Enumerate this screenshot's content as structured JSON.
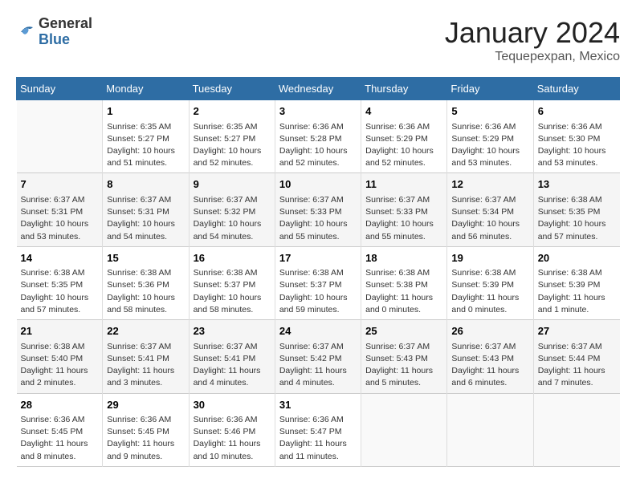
{
  "header": {
    "logo_general": "General",
    "logo_blue": "Blue",
    "month_title": "January 2024",
    "location": "Tequepexpan, Mexico"
  },
  "days_of_week": [
    "Sunday",
    "Monday",
    "Tuesday",
    "Wednesday",
    "Thursday",
    "Friday",
    "Saturday"
  ],
  "weeks": [
    [
      {
        "day": "",
        "empty": true
      },
      {
        "day": "1",
        "sunrise": "6:35 AM",
        "sunset": "5:27 PM",
        "daylight": "10 hours and 51 minutes."
      },
      {
        "day": "2",
        "sunrise": "6:35 AM",
        "sunset": "5:27 PM",
        "daylight": "10 hours and 52 minutes."
      },
      {
        "day": "3",
        "sunrise": "6:36 AM",
        "sunset": "5:28 PM",
        "daylight": "10 hours and 52 minutes."
      },
      {
        "day": "4",
        "sunrise": "6:36 AM",
        "sunset": "5:29 PM",
        "daylight": "10 hours and 52 minutes."
      },
      {
        "day": "5",
        "sunrise": "6:36 AM",
        "sunset": "5:29 PM",
        "daylight": "10 hours and 53 minutes."
      },
      {
        "day": "6",
        "sunrise": "6:36 AM",
        "sunset": "5:30 PM",
        "daylight": "10 hours and 53 minutes."
      }
    ],
    [
      {
        "day": "7",
        "sunrise": "6:37 AM",
        "sunset": "5:31 PM",
        "daylight": "10 hours and 53 minutes."
      },
      {
        "day": "8",
        "sunrise": "6:37 AM",
        "sunset": "5:31 PM",
        "daylight": "10 hours and 54 minutes."
      },
      {
        "day": "9",
        "sunrise": "6:37 AM",
        "sunset": "5:32 PM",
        "daylight": "10 hours and 54 minutes."
      },
      {
        "day": "10",
        "sunrise": "6:37 AM",
        "sunset": "5:33 PM",
        "daylight": "10 hours and 55 minutes."
      },
      {
        "day": "11",
        "sunrise": "6:37 AM",
        "sunset": "5:33 PM",
        "daylight": "10 hours and 55 minutes."
      },
      {
        "day": "12",
        "sunrise": "6:37 AM",
        "sunset": "5:34 PM",
        "daylight": "10 hours and 56 minutes."
      },
      {
        "day": "13",
        "sunrise": "6:38 AM",
        "sunset": "5:35 PM",
        "daylight": "10 hours and 57 minutes."
      }
    ],
    [
      {
        "day": "14",
        "sunrise": "6:38 AM",
        "sunset": "5:35 PM",
        "daylight": "10 hours and 57 minutes."
      },
      {
        "day": "15",
        "sunrise": "6:38 AM",
        "sunset": "5:36 PM",
        "daylight": "10 hours and 58 minutes."
      },
      {
        "day": "16",
        "sunrise": "6:38 AM",
        "sunset": "5:37 PM",
        "daylight": "10 hours and 58 minutes."
      },
      {
        "day": "17",
        "sunrise": "6:38 AM",
        "sunset": "5:37 PM",
        "daylight": "10 hours and 59 minutes."
      },
      {
        "day": "18",
        "sunrise": "6:38 AM",
        "sunset": "5:38 PM",
        "daylight": "11 hours and 0 minutes."
      },
      {
        "day": "19",
        "sunrise": "6:38 AM",
        "sunset": "5:39 PM",
        "daylight": "11 hours and 0 minutes."
      },
      {
        "day": "20",
        "sunrise": "6:38 AM",
        "sunset": "5:39 PM",
        "daylight": "11 hours and 1 minute."
      }
    ],
    [
      {
        "day": "21",
        "sunrise": "6:38 AM",
        "sunset": "5:40 PM",
        "daylight": "11 hours and 2 minutes."
      },
      {
        "day": "22",
        "sunrise": "6:37 AM",
        "sunset": "5:41 PM",
        "daylight": "11 hours and 3 minutes."
      },
      {
        "day": "23",
        "sunrise": "6:37 AM",
        "sunset": "5:41 PM",
        "daylight": "11 hours and 4 minutes."
      },
      {
        "day": "24",
        "sunrise": "6:37 AM",
        "sunset": "5:42 PM",
        "daylight": "11 hours and 4 minutes."
      },
      {
        "day": "25",
        "sunrise": "6:37 AM",
        "sunset": "5:43 PM",
        "daylight": "11 hours and 5 minutes."
      },
      {
        "day": "26",
        "sunrise": "6:37 AM",
        "sunset": "5:43 PM",
        "daylight": "11 hours and 6 minutes."
      },
      {
        "day": "27",
        "sunrise": "6:37 AM",
        "sunset": "5:44 PM",
        "daylight": "11 hours and 7 minutes."
      }
    ],
    [
      {
        "day": "28",
        "sunrise": "6:36 AM",
        "sunset": "5:45 PM",
        "daylight": "11 hours and 8 minutes."
      },
      {
        "day": "29",
        "sunrise": "6:36 AM",
        "sunset": "5:45 PM",
        "daylight": "11 hours and 9 minutes."
      },
      {
        "day": "30",
        "sunrise": "6:36 AM",
        "sunset": "5:46 PM",
        "daylight": "11 hours and 10 minutes."
      },
      {
        "day": "31",
        "sunrise": "6:36 AM",
        "sunset": "5:47 PM",
        "daylight": "11 hours and 11 minutes."
      },
      {
        "day": "",
        "empty": true
      },
      {
        "day": "",
        "empty": true
      },
      {
        "day": "",
        "empty": true
      }
    ]
  ],
  "labels": {
    "sunrise_prefix": "Sunrise:",
    "sunset_prefix": "Sunset:",
    "daylight_prefix": "Daylight:"
  }
}
